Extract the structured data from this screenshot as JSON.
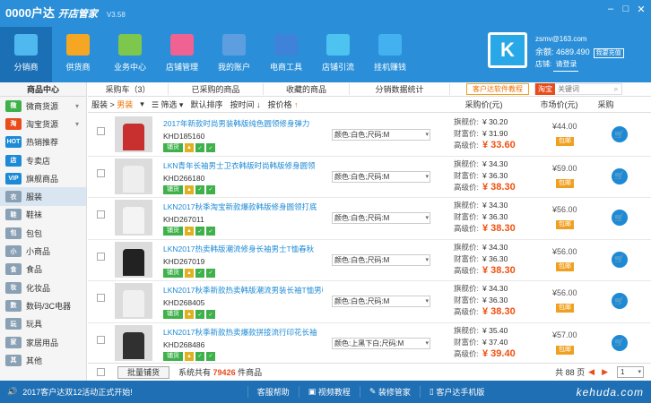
{
  "app": {
    "logo": "0000户达",
    "subtitle": "开店管家",
    "version": "V3.58",
    "window_controls": [
      "–",
      "□",
      "✕"
    ]
  },
  "nav": [
    {
      "label": "分销商",
      "icon": "upload-icon",
      "color": "#4fb8ef",
      "active": true
    },
    {
      "label": "供货商",
      "icon": "download-icon",
      "color": "#f5a623",
      "active": false
    },
    {
      "label": "业务中心",
      "icon": "grid-icon",
      "color": "#7cc74c",
      "active": false
    },
    {
      "label": "店铺管理",
      "icon": "store-icon",
      "color": "#f06292",
      "active": false
    },
    {
      "label": "我的账户",
      "icon": "id-card-icon",
      "color": "#5c9ee0",
      "active": false
    },
    {
      "label": "电商工具",
      "icon": "briefcase-icon",
      "color": "#3e83d9",
      "active": false
    },
    {
      "label": "店铺引流",
      "icon": "magnet-icon",
      "color": "#4dc3f0",
      "active": false
    },
    {
      "label": "挂机赚钱",
      "icon": "monitor-icon",
      "color": "#43b0f0",
      "active": false
    }
  ],
  "account": {
    "shop_logo": "K",
    "email": "zsmv@163.com",
    "balance_label": "余额:",
    "balance": "4689.490",
    "recharge": "我要充值",
    "shop_label": "店铺:",
    "shop": "请登录"
  },
  "sidebar": {
    "title": "商品中心",
    "items": [
      {
        "label": "微商货源",
        "icon": "wechat-icon",
        "icon_text": "微",
        "color": "#3fb14b",
        "arrow": true,
        "active": false
      },
      {
        "label": "淘宝货源",
        "icon": "taobao-icon",
        "icon_text": "淘",
        "color": "#e84c1c",
        "arrow": true,
        "active": false
      },
      {
        "label": "热销推荐",
        "icon": "hot-icon",
        "icon_text": "HOT",
        "color": "#1c8ad6",
        "arrow": false,
        "active": false
      },
      {
        "label": "专卖店",
        "icon": "shop-icon",
        "icon_text": "店",
        "color": "#1c8ad6",
        "arrow": false,
        "active": false
      },
      {
        "label": "旗舰商品",
        "icon": "vip-icon",
        "icon_text": "VIP",
        "color": "#1c8ad6",
        "arrow": false,
        "active": false
      },
      {
        "label": "服装",
        "icon": "clothes-icon",
        "icon_text": "衣",
        "color": "#8aa0b4",
        "arrow": false,
        "active": true
      },
      {
        "label": "鞋袜",
        "icon": "shoe-icon",
        "icon_text": "鞋",
        "color": "#8aa0b4",
        "arrow": false,
        "active": false
      },
      {
        "label": "包包",
        "icon": "bag-icon",
        "icon_text": "包",
        "color": "#8aa0b4",
        "arrow": false,
        "active": false
      },
      {
        "label": "小商品",
        "icon": "gift-icon",
        "icon_text": "小",
        "color": "#8aa0b4",
        "arrow": false,
        "active": false
      },
      {
        "label": "食品",
        "icon": "food-icon",
        "icon_text": "食",
        "color": "#8aa0b4",
        "arrow": false,
        "active": false
      },
      {
        "label": "化妆品",
        "icon": "cosmetics-icon",
        "icon_text": "妆",
        "color": "#8aa0b4",
        "arrow": false,
        "active": false
      },
      {
        "label": "数码/3C电器",
        "icon": "digital-icon",
        "icon_text": "数",
        "color": "#8aa0b4",
        "arrow": false,
        "active": false
      },
      {
        "label": "玩具",
        "icon": "toy-icon",
        "icon_text": "玩",
        "color": "#8aa0b4",
        "arrow": false,
        "active": false
      },
      {
        "label": "家居用品",
        "icon": "home-icon",
        "icon_text": "家",
        "color": "#8aa0b4",
        "arrow": false,
        "active": false
      },
      {
        "label": "其他",
        "icon": "other-icon",
        "icon_text": "其",
        "color": "#8aa0b4",
        "arrow": false,
        "active": false
      }
    ]
  },
  "tabs": [
    "采购车（3）",
    "已采购的商品",
    "收藏的商品",
    "分销数据统计"
  ],
  "promo": "客户达软件教程",
  "search": {
    "platform": "淘宝",
    "placeholder": "关键词"
  },
  "filter": {
    "breadcrumb_prefix": "服装",
    "breadcrumb_current": "男装",
    "filter_label": "筛选",
    "sort_default": "默认排序",
    "sort_time": "按时间",
    "sort_price": "按价格",
    "col_purchase_price": "采购价(元)",
    "col_market_price": "市场价(元)",
    "col_buy": "采购"
  },
  "rows": [
    {
      "title": "2017年新款时尚男装韩版纯色圆领修身弹力",
      "code": "KHD185160",
      "attr": "颜色:白色;尺码:M",
      "price_flagship": "¥ 30.20",
      "price_rich": "¥ 31.90",
      "price_high": "¥ 33.60",
      "market": "¥44.00",
      "shirt": "#c83030"
    },
    {
      "title": "LKN青年长袖男士卫衣韩版时尚韩版修身圆领",
      "code": "KHD266180",
      "attr": "颜色:白色;尺码:M",
      "price_flagship": "¥ 34.30",
      "price_rich": "¥ 36.30",
      "price_high": "¥ 38.30",
      "market": "¥59.00",
      "shirt": "#eeeeee"
    },
    {
      "title": "LKN2017秋季淘宝新款爆款韩版修身圆领打底",
      "code": "KHD267011",
      "attr": "颜色:白色;尺码:M",
      "price_flagship": "¥ 34.30",
      "price_rich": "¥ 36.30",
      "price_high": "¥ 38.30",
      "market": "¥56.00",
      "shirt": "#f4f4f4"
    },
    {
      "title": "LKN2017热卖韩版潮流修身长袖男士T恤春秋",
      "code": "KHD267019",
      "attr": "颜色:白色;尺码:M",
      "price_flagship": "¥ 34.30",
      "price_rich": "¥ 36.30",
      "price_high": "¥ 38.30",
      "market": "¥56.00",
      "shirt": "#222222"
    },
    {
      "title": "LKN2017秋季新款热卖韩版潮流男装长袖T恤男韩",
      "code": "KHD268405",
      "attr": "颜色:白色;尺码:M",
      "price_flagship": "¥ 34.30",
      "price_rich": "¥ 36.30",
      "price_high": "¥ 38.30",
      "market": "¥56.00",
      "shirt": "#f0f0f0"
    },
    {
      "title": "LKN2017秋季新款热卖爆款拼接流行印花长袖",
      "code": "KHD268486",
      "attr": "颜色:上黑下白;尺码:M",
      "price_flagship": "¥ 35.40",
      "price_rich": "¥ 37.40",
      "price_high": "¥ 39.40",
      "market": "¥57.00",
      "shirt": "#303030"
    }
  ],
  "labels": {
    "flagship": "旗舰价:",
    "rich": "财富价:",
    "high": "高级价:",
    "publish": "铺货",
    "pkg": "包邮",
    "cart": "🛒"
  },
  "bottom": {
    "batch": "批量铺货",
    "total_prefix": "系统共有",
    "total_count": "79426",
    "total_suffix": "件商品",
    "pages_label": "共 88 页",
    "page": "1"
  },
  "footer": {
    "notice": "2017客户达双12活动正式开始!",
    "links": [
      "客服帮助",
      "视频教程",
      "装修管家",
      "客户达手机版"
    ],
    "site": "kehuda.com"
  }
}
